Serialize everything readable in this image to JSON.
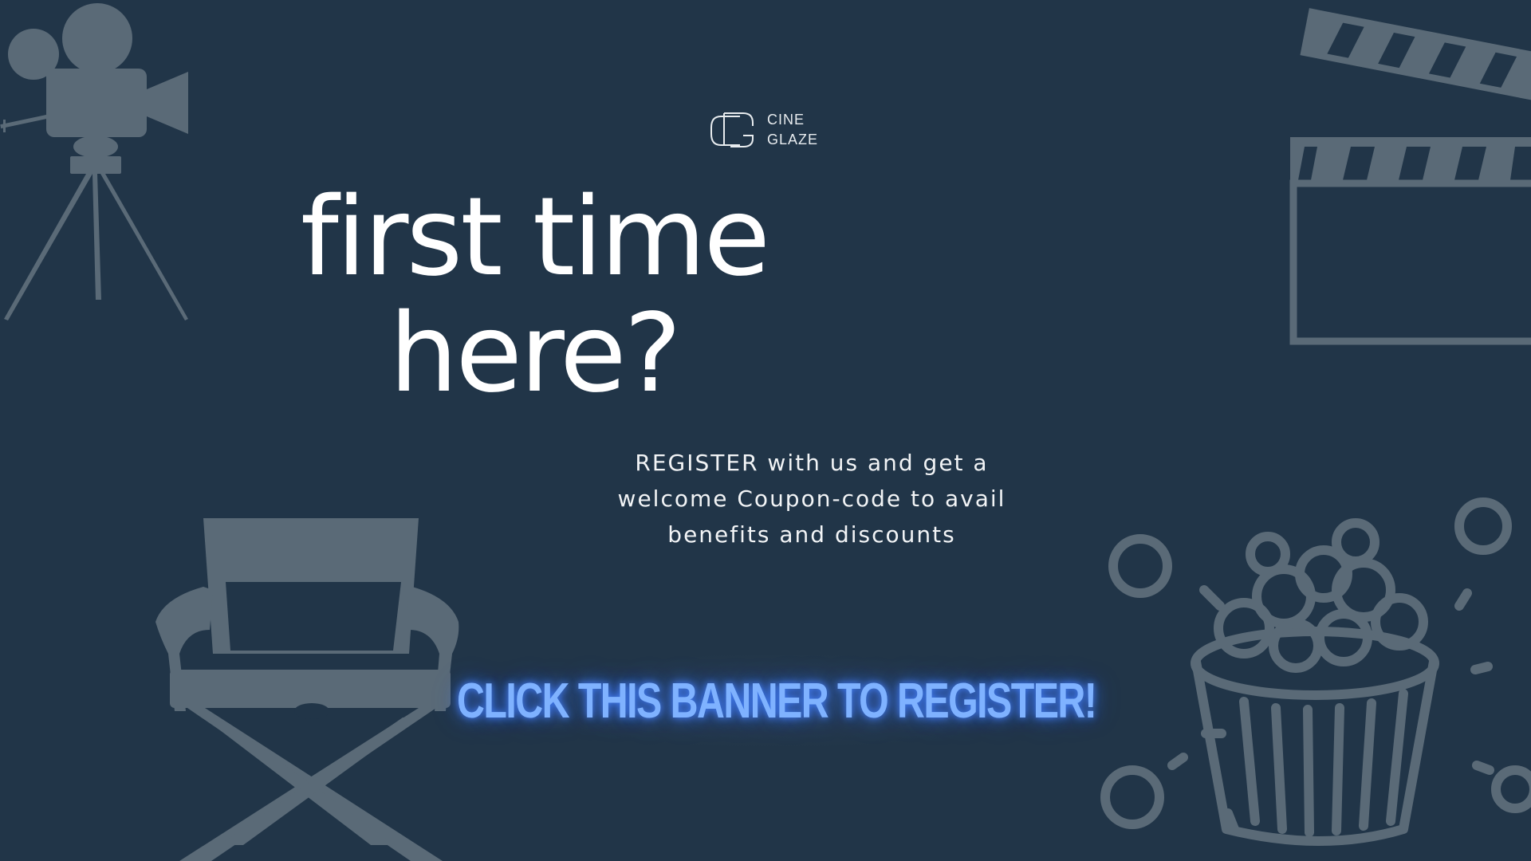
{
  "brand": {
    "line1": "CINE",
    "line2": "GLAZE"
  },
  "headline": {
    "line1": "first time",
    "line2": "here?"
  },
  "description": {
    "line1": "REGISTER with us and get a",
    "line2": "welcome Coupon-code to avail",
    "line3": "benefits and discounts"
  },
  "cta": {
    "label": "CLICK THIS BANNER TO REGISTER!"
  },
  "colors": {
    "background": "#213548",
    "illustration": "#5a6a77",
    "headline": "#ffffff",
    "cta_glow": "#7fb2ff"
  },
  "icons": [
    "movie-camera-icon",
    "clapperboard-icon",
    "directors-chair-icon",
    "popcorn-bucket-icon",
    "brand-logo-icon"
  ]
}
